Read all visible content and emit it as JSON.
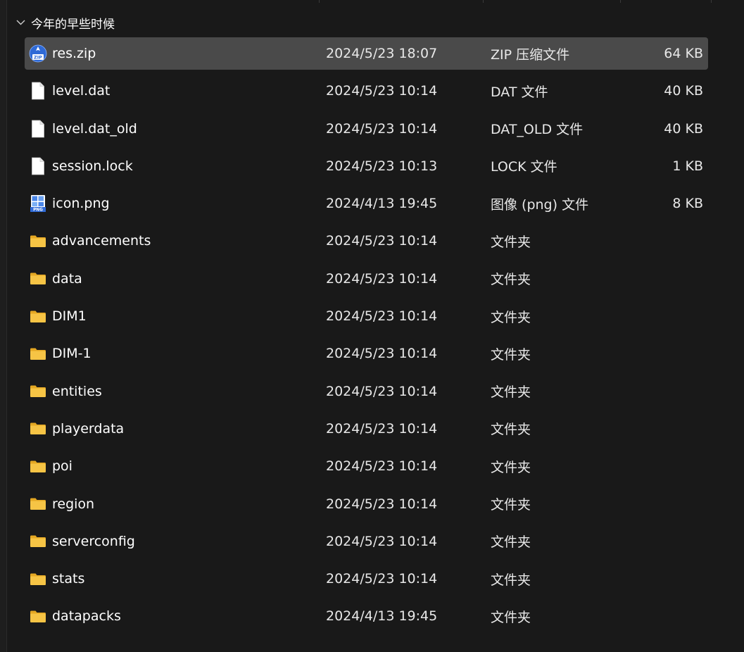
{
  "group": {
    "label": "今年的早些时候"
  },
  "files": [
    {
      "name": "res.zip",
      "date": "2024/5/23 18:07",
      "type": "ZIP 压缩文件",
      "size": "64 KB",
      "icon": "zip-icon",
      "selected": true
    },
    {
      "name": "level.dat",
      "date": "2024/5/23 10:14",
      "type": "DAT 文件",
      "size": "40 KB",
      "icon": "file-icon",
      "selected": false
    },
    {
      "name": "level.dat_old",
      "date": "2024/5/23 10:14",
      "type": "DAT_OLD 文件",
      "size": "40 KB",
      "icon": "file-icon",
      "selected": false
    },
    {
      "name": "session.lock",
      "date": "2024/5/23 10:13",
      "type": "LOCK 文件",
      "size": "1 KB",
      "icon": "file-icon",
      "selected": false
    },
    {
      "name": "icon.png",
      "date": "2024/4/13 19:45",
      "type": "图像 (png) 文件",
      "size": "8 KB",
      "icon": "png-icon",
      "selected": false
    },
    {
      "name": "advancements",
      "date": "2024/5/23 10:14",
      "type": "文件夹",
      "size": "",
      "icon": "folder-icon",
      "selected": false
    },
    {
      "name": "data",
      "date": "2024/5/23 10:14",
      "type": "文件夹",
      "size": "",
      "icon": "folder-icon",
      "selected": false
    },
    {
      "name": "DIM1",
      "date": "2024/5/23 10:14",
      "type": "文件夹",
      "size": "",
      "icon": "folder-icon",
      "selected": false
    },
    {
      "name": "DIM-1",
      "date": "2024/5/23 10:14",
      "type": "文件夹",
      "size": "",
      "icon": "folder-icon",
      "selected": false
    },
    {
      "name": "entities",
      "date": "2024/5/23 10:14",
      "type": "文件夹",
      "size": "",
      "icon": "folder-icon",
      "selected": false
    },
    {
      "name": "playerdata",
      "date": "2024/5/23 10:14",
      "type": "文件夹",
      "size": "",
      "icon": "folder-icon",
      "selected": false
    },
    {
      "name": "poi",
      "date": "2024/5/23 10:14",
      "type": "文件夹",
      "size": "",
      "icon": "folder-icon",
      "selected": false
    },
    {
      "name": "region",
      "date": "2024/5/23 10:14",
      "type": "文件夹",
      "size": "",
      "icon": "folder-icon",
      "selected": false
    },
    {
      "name": "serverconfig",
      "date": "2024/5/23 10:14",
      "type": "文件夹",
      "size": "",
      "icon": "folder-icon",
      "selected": false
    },
    {
      "name": "stats",
      "date": "2024/5/23 10:14",
      "type": "文件夹",
      "size": "",
      "icon": "folder-icon",
      "selected": false
    },
    {
      "name": "datapacks",
      "date": "2024/4/13 19:45",
      "type": "文件夹",
      "size": "",
      "icon": "folder-icon",
      "selected": false
    }
  ],
  "colors": {
    "background": "#191919",
    "selected_row": "#4a4a4a",
    "folder": "#f6c445",
    "text": "#ffffff"
  }
}
